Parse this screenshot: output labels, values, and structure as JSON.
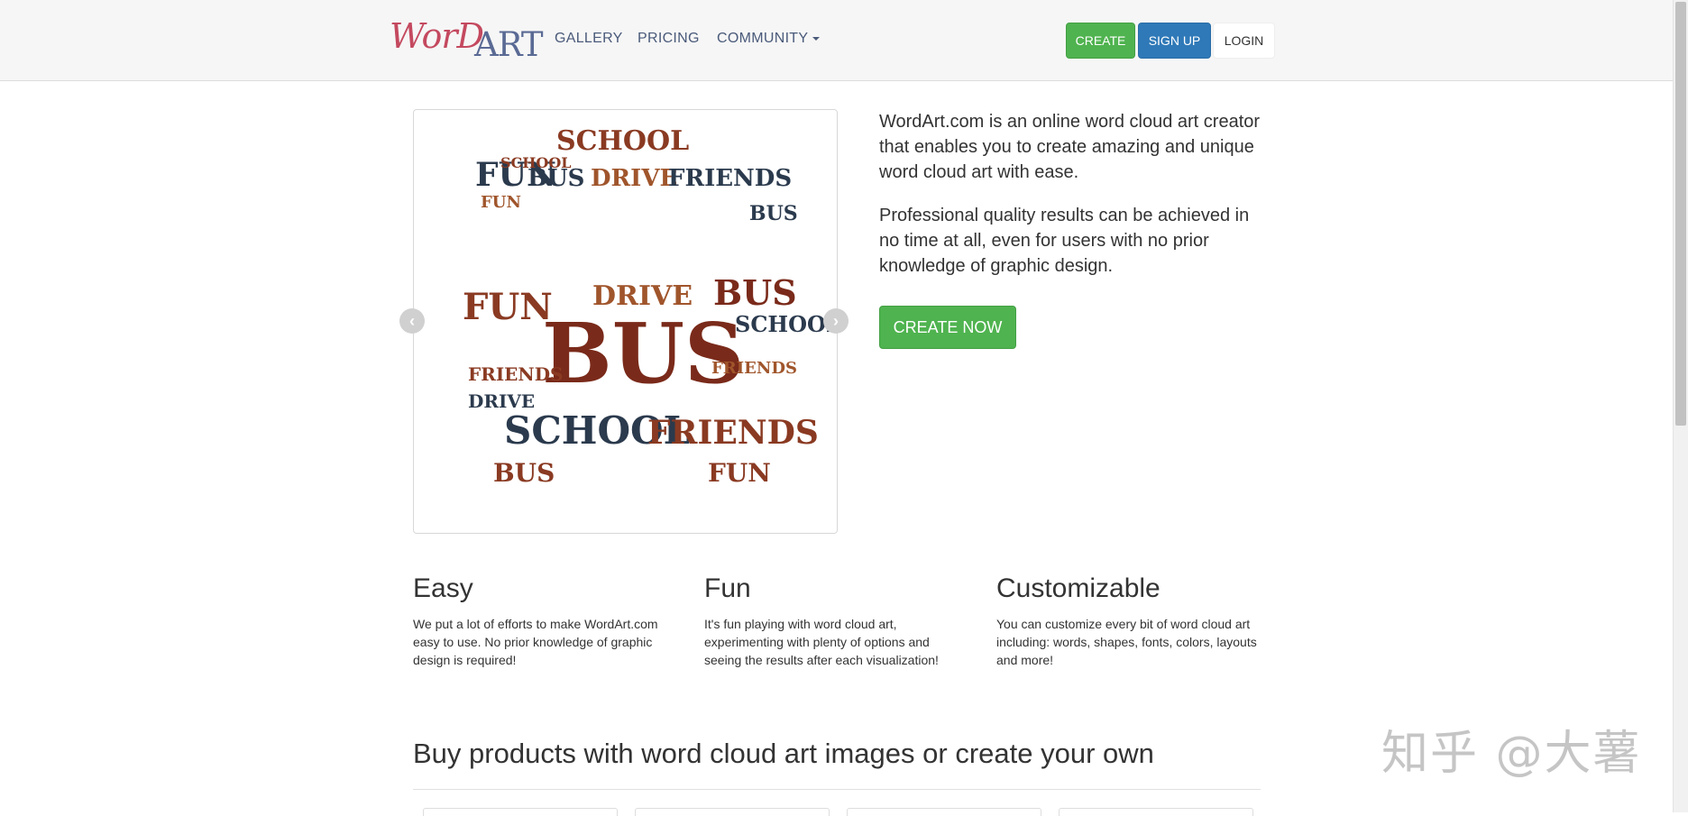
{
  "nav": {
    "logo_part1": "WorD",
    "logo_part2": "ART",
    "links": [
      "GALLERY",
      "PRICING",
      "COMMUNITY"
    ],
    "create_label": "CREATE",
    "signup_label": "SIGN UP",
    "login_label": "LOGIN"
  },
  "hero": {
    "p1": "WordArt.com is an online word cloud art creator that enables you to create amazing and unique word cloud art with ease.",
    "p2": "Professional quality results can be achieved in no time at all, even for users with no prior knowledge of graphic design.",
    "cta_label": "CREATE NOW",
    "carousel_prev": "‹",
    "carousel_next": "›",
    "word_cloud": {
      "words": [
        {
          "text": "BUS",
          "color": "#7a2a1a"
        },
        {
          "text": "SCHOOL",
          "color": "#8a3a22"
        },
        {
          "text": "FUN",
          "color": "#2b3a4d"
        },
        {
          "text": "BUS",
          "color": "#2b3a4d"
        },
        {
          "text": "DRIVE",
          "color": "#a0552b"
        },
        {
          "text": "FRIENDS",
          "color": "#2b3a4d"
        },
        {
          "text": "FUN",
          "color": "#8a3a22"
        },
        {
          "text": "DRIVE",
          "color": "#a0552b"
        },
        {
          "text": "BUS",
          "color": "#7a2a1a"
        },
        {
          "text": "SCHOOL",
          "color": "#2b3a4d"
        },
        {
          "text": "SCHOOL",
          "color": "#2b3a4d"
        },
        {
          "text": "FRIENDS",
          "color": "#8a3a22"
        },
        {
          "text": "BUS",
          "color": "#8a3a22"
        },
        {
          "text": "FUN",
          "color": "#8a3a22"
        },
        {
          "text": "BUS",
          "color": "#2b3a4d"
        },
        {
          "text": "FUN",
          "color": "#a0552b"
        },
        {
          "text": "FRIENDS",
          "color": "#8a3a22"
        },
        {
          "text": "DRIVE",
          "color": "#2b3a4d"
        },
        {
          "text": "SCHOOL",
          "color": "#8a3a22"
        },
        {
          "text": "FRIENDS",
          "color": "#a0552b"
        }
      ]
    }
  },
  "features": [
    {
      "title": "Easy",
      "desc": "We put a lot of efforts to make WordArt.com easy to use. No prior knowledge of graphic design is required!"
    },
    {
      "title": "Fun",
      "desc": "It's fun playing with word cloud art, experimenting with plenty of options and seeing the results after each visualization!"
    },
    {
      "title": "Customizable",
      "desc": "You can customize every bit of word cloud art including: words, shapes, fonts, colors, layouts and more!"
    }
  ],
  "products": {
    "title": "Buy products with word cloud art images or create your own"
  },
  "watermark": "知乎 @大薯"
}
